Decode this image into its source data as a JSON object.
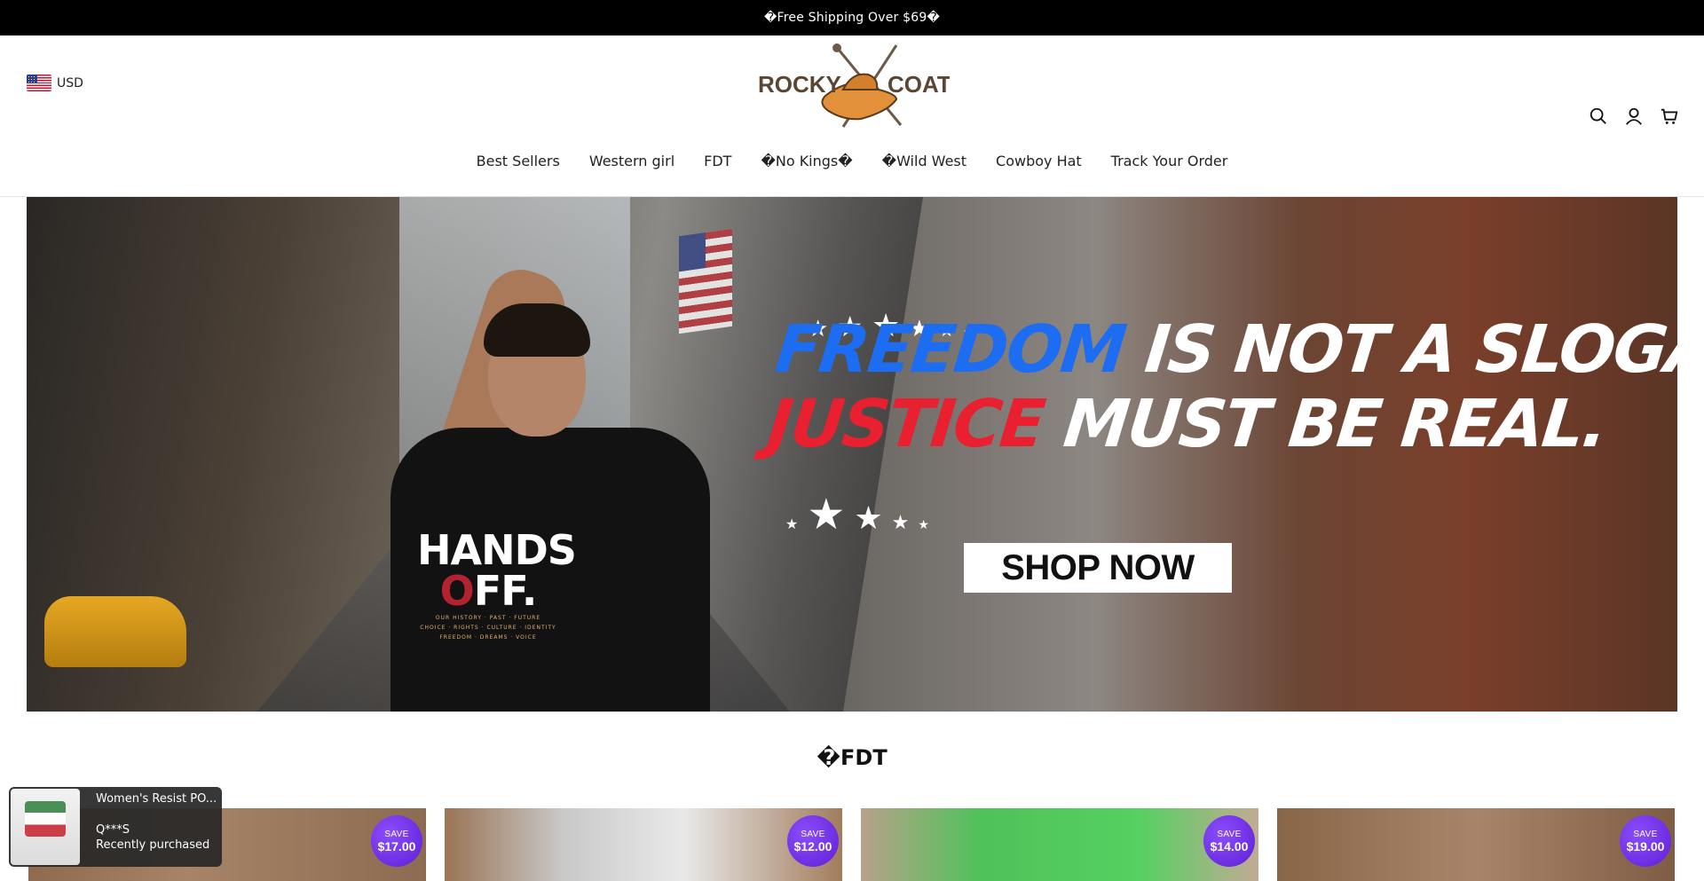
{
  "announcement": {
    "text": "�Free Shipping Over $69�"
  },
  "header": {
    "currency": "USD",
    "logo": {
      "left_text": "ROCKY",
      "right_text": "COAT"
    },
    "icons": {
      "search": "search-icon",
      "account": "user-icon",
      "cart": "cart-icon"
    }
  },
  "nav": {
    "items": [
      {
        "label": "Best Sellers"
      },
      {
        "label": "Western girl"
      },
      {
        "label": "FDT"
      },
      {
        "label": "�No Kings�"
      },
      {
        "label": "�Wild West"
      },
      {
        "label": "Cowboy Hat"
      },
      {
        "label": "Track Your Order"
      }
    ]
  },
  "hero": {
    "line1_a": "FREEDOM",
    "line1_b": " IS NOT A SLOGAN",
    "line2_a": "JUSTICE",
    "line2_b": " MUST BE REAL.",
    "cta": "SHOP NOW",
    "tee": {
      "big_line1": "HANDS",
      "big_line2_a": "O",
      "big_line2_b": "FF.",
      "small_line1": "OUR HISTORY · PAST · FUTURE",
      "small_line2": "CHOICE · RIGHTS · CULTURE · IDENTITY",
      "small_line3": "FREEDOM · DREAMS · VOICE"
    }
  },
  "section": {
    "title": "�FDT"
  },
  "products": [
    {
      "save_label": "SAVE",
      "save_amount": "$17.00"
    },
    {
      "save_label": "SAVE",
      "save_amount": "$12.00"
    },
    {
      "save_label": "SAVE",
      "save_amount": "$14.00"
    },
    {
      "save_label": "SAVE",
      "save_amount": "$19.00"
    }
  ],
  "popup": {
    "title": "Women's Resist PO...",
    "buyer": "Q***S",
    "status": "Recently purchased"
  },
  "colors": {
    "announcement_bg": "#000000",
    "save_badge": "#6a2ee6",
    "headline_blue": "#1d6df2",
    "headline_red": "#e8202f"
  }
}
